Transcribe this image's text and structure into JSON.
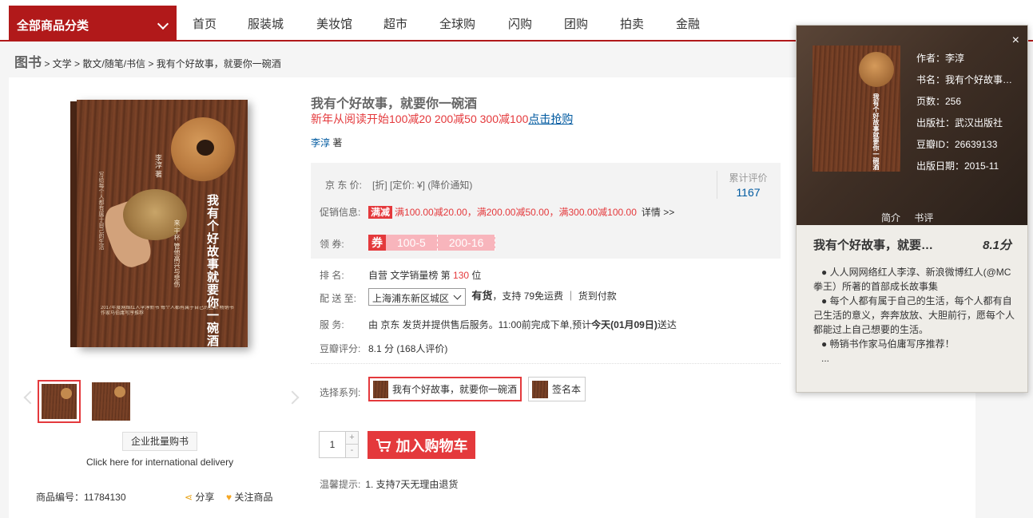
{
  "nav": {
    "all_categories": "全部商品分类",
    "links": [
      "首页",
      "服装城",
      "美妆馆",
      "超市",
      "全球购",
      "闪购",
      "团购",
      "拍卖",
      "金融"
    ]
  },
  "breadcrumb": {
    "root": "图书",
    "path": "> 文学 > 散文/随笔/书信 >",
    "current": "我有个好故事，就要你一碗酒"
  },
  "cover": {
    "title": "我有个好故事就要你一碗酒",
    "author": "李淳 著",
    "small": "写给每个人都有属于自己的生活",
    "quote": "来·干杯 管他高兴与悲伤",
    "band": "2017年度网络红人李淳新书 每个人都有属于自己的生活 畅销书作家马伯庸写序推荐"
  },
  "thumbs": [
    "cover-front",
    "cover-alt"
  ],
  "actions": {
    "bulk_buy": "企业批量购书",
    "international": "Click here for international delivery",
    "sku_label": "商品编号：11784130",
    "share": "分享",
    "follow": "关注商品"
  },
  "product": {
    "title": "我有个好故事，就要你一碗酒",
    "promo_text": "新年从阅读开始100减20 200减50 300减100",
    "promo_link": "点击抢购",
    "author_name": "李淳",
    "author_suffix": "著"
  },
  "price": {
    "label": "京 东 价:",
    "line": "[折]  [定价: ¥]  (降价通知)",
    "promo_label": "促销信息:",
    "promo_tag": "满减",
    "promo_desc": "满100.00减20.00，满200.00减50.00，满300.00减100.00",
    "promo_more": "详情 >>",
    "coupon_label": "领      券:",
    "coupon_icon": "券",
    "coupons": [
      "100-5",
      "200-16"
    ],
    "reviews_label": "累计评价",
    "reviews_count": "1167"
  },
  "info": {
    "rank_label": "排      名:",
    "rank_text_1": "自营 文学销量榜 第",
    "rank_num": "130",
    "rank_text_2": "位",
    "ship_label": "配 送 至:",
    "ship_value": "上海浦东新区城区",
    "ship_stock": "有货",
    "ship_text": "，支持 79免运费 ｜ 货到付款",
    "service_label": "服      务:",
    "service_text_1": "由 京东 发货并提供售后服务。11:00前完成下单,预计",
    "service_date": "今天(01月09日)",
    "service_text_2": "送达",
    "douban_label": "豆瓣评分:",
    "douban_value": "8.1 分 (168人评价)"
  },
  "series": {
    "label": "选择系列:",
    "options": [
      "我有个好故事，就要你一碗酒",
      "签名本"
    ]
  },
  "cart": {
    "quantity": "1",
    "plus": "+",
    "minus": "-",
    "button": "加入购物车",
    "tips_label": "温馨提示:",
    "tips_text": "1. 支持7天无理由退货"
  },
  "popup": {
    "close": "×",
    "meta": [
      "作者：李淳",
      "书名：我有个好故事…",
      "页数：256",
      "出版社：武汉出版社",
      "豆瓣ID：26639133",
      "出版日期：2015-11"
    ],
    "tabs": [
      "简介",
      "书评"
    ],
    "title": "我有个好故事，就要…",
    "score": "8.1分",
    "desc": [
      "● 人人网网络红人李淳、新浪微博红人(@MC拳王）所著的首部成长故事集",
      "● 每个人都有属于自己的生活，每个人都有自己生活的意义，奔奔放放、大胆前行，愿每个人都能过上自己想要的生活。",
      "● 畅销书作家马伯庸写序推荐！",
      "..."
    ]
  },
  "colors": {
    "brand_red": "#b1191a",
    "accent_red": "#e4393c",
    "link_blue": "#005aa0"
  }
}
